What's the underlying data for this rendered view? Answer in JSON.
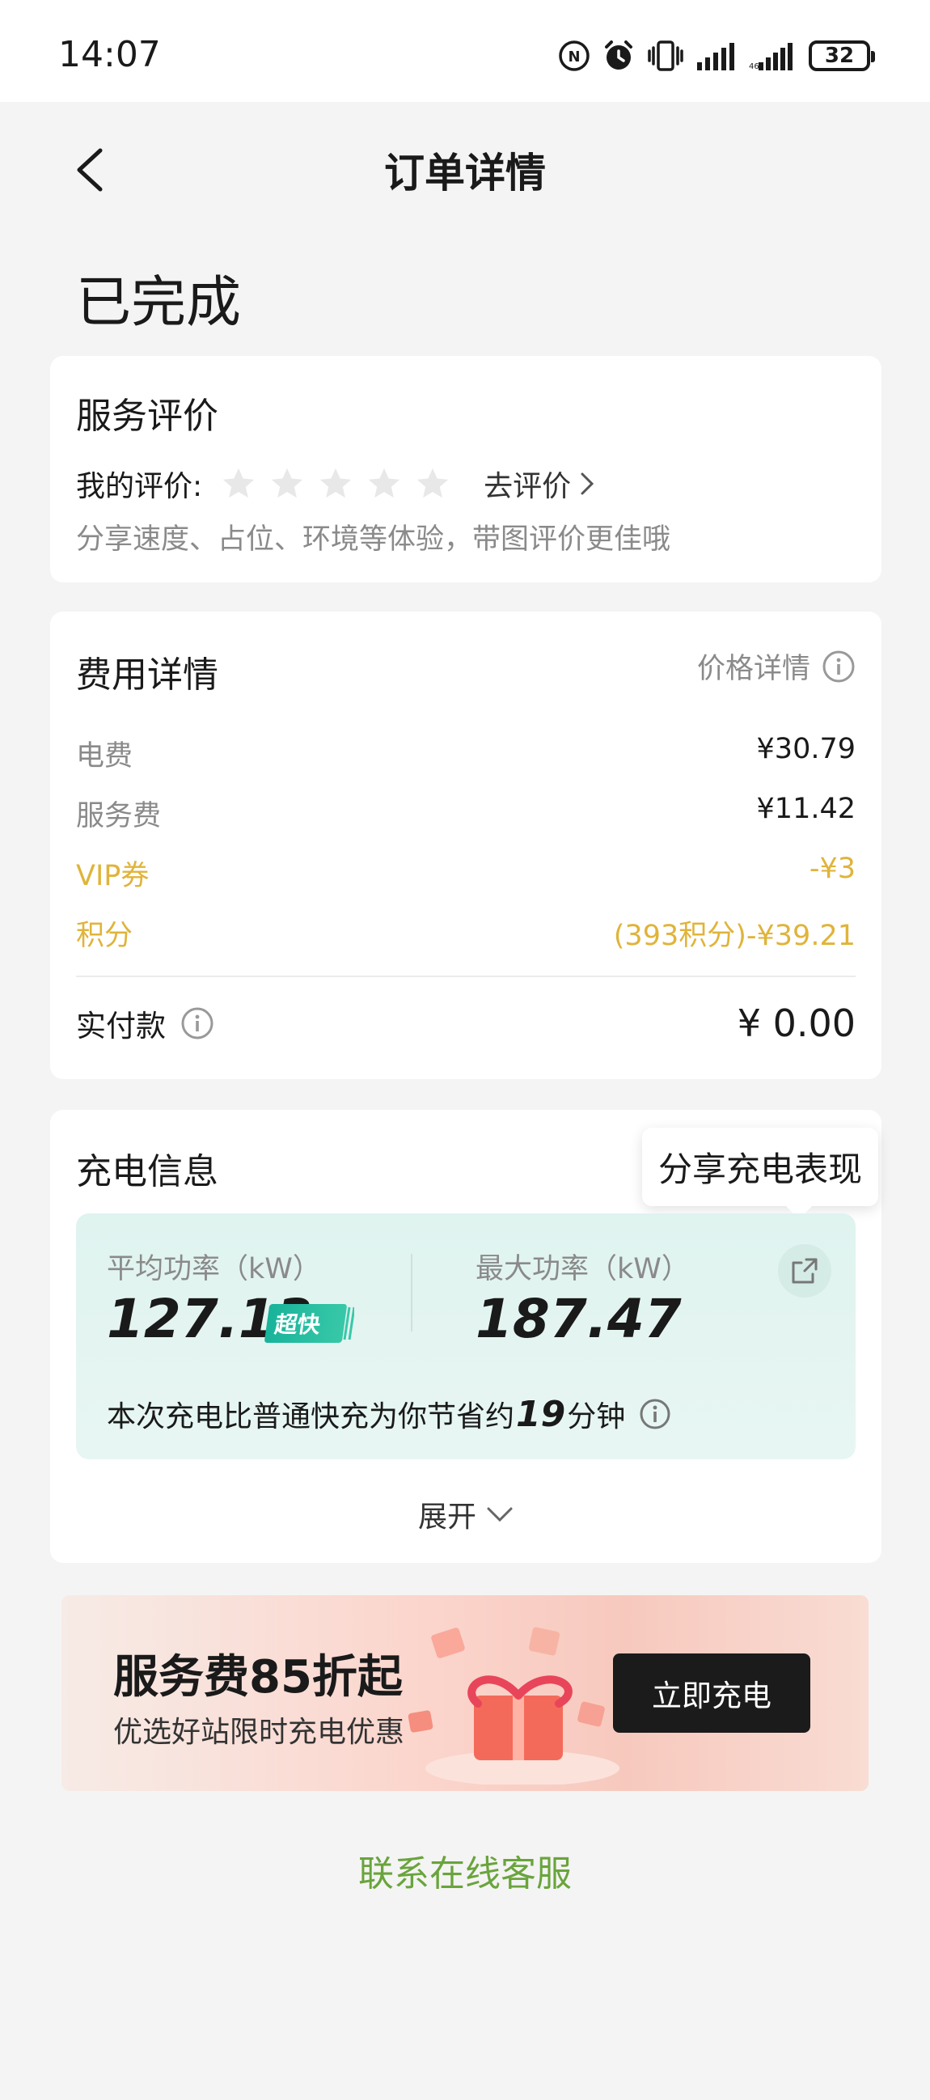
{
  "status_bar": {
    "time": "14:07",
    "battery": "32",
    "icons": [
      "nfc-icon",
      "alarm-icon",
      "vibrate-icon",
      "signal-icon",
      "signal-icon"
    ]
  },
  "nav": {
    "title": "订单详情"
  },
  "order_status": "已完成",
  "rating": {
    "title": "服务评价",
    "label": "我的评价:",
    "stars_filled": 0,
    "stars_total": 5,
    "action": "去评价",
    "hint": "分享速度、占位、环境等体验，带图评价更佳哦"
  },
  "fees": {
    "title": "费用详情",
    "price_detail": "价格详情",
    "rows": [
      {
        "label": "电费",
        "value": "¥30.79"
      },
      {
        "label": "服务费",
        "value": "¥11.42"
      },
      {
        "label": "VIP券",
        "value": "-¥3"
      },
      {
        "label": "积分",
        "value": "(393积分)-¥39.21"
      }
    ],
    "paid_label": "实付款",
    "paid_value": "¥ 0.00"
  },
  "charging": {
    "title": "充电信息",
    "tooltip": "分享充电表现",
    "avg_label": "平均功率（kW）",
    "avg_value": "127.13",
    "badge": "超快",
    "max_label": "最大功率（kW）",
    "max_value": "187.47",
    "save_prefix": "本次充电比普通快充为你节省约",
    "save_minutes": "19",
    "save_suffix": "分钟",
    "expand": "展开"
  },
  "banner": {
    "title": "服务费85折起",
    "subtitle": "优选好站限时充电优惠",
    "button": "立即充电"
  },
  "support": "联系在线客服",
  "colors": {
    "accent_green": "#6aa43c",
    "gold": "#e0b43a",
    "teal": "#18b39a"
  }
}
